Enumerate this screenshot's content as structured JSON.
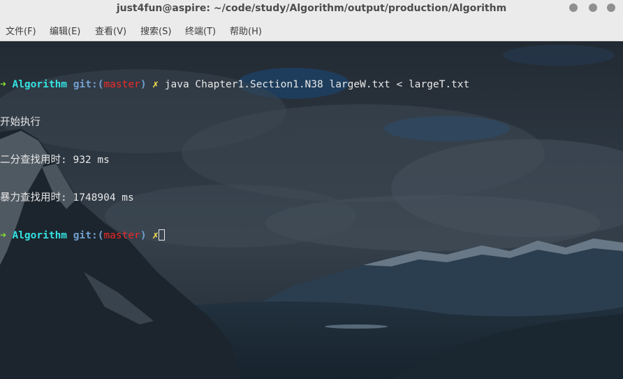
{
  "window": {
    "title": "just4fun@aspire: ~/code/study/Algorithm/output/production/Algorithm"
  },
  "menu": {
    "items": [
      {
        "label": "文件(F)"
      },
      {
        "label": "编辑(E)"
      },
      {
        "label": "查看(V)"
      },
      {
        "label": "搜索(S)"
      },
      {
        "label": "终端(T)"
      },
      {
        "label": "帮助(H)"
      }
    ]
  },
  "terminal": {
    "prompt": {
      "arrow": "➜",
      "dir": "Algorithm",
      "git_prefix": "git:(",
      "branch": "master",
      "git_suffix": ")",
      "dirty_mark": "✗"
    },
    "command": " java Chapter1.Section1.N38 largeW.txt < largeT.txt",
    "output": [
      "开始执行",
      "二分查找用时: 932 ms",
      "暴力查找用时: 1748904 ms"
    ]
  },
  "colors": {
    "prompt_arrow": "#8ae234",
    "prompt_dir": "#34e2e2",
    "git": "#729fcf",
    "branch": "#ef2929",
    "dirty": "#fce94f",
    "titlebar": "#ebebeb"
  },
  "icons": [
    "window-control-icon",
    "window-control-icon",
    "window-control-icon"
  ]
}
